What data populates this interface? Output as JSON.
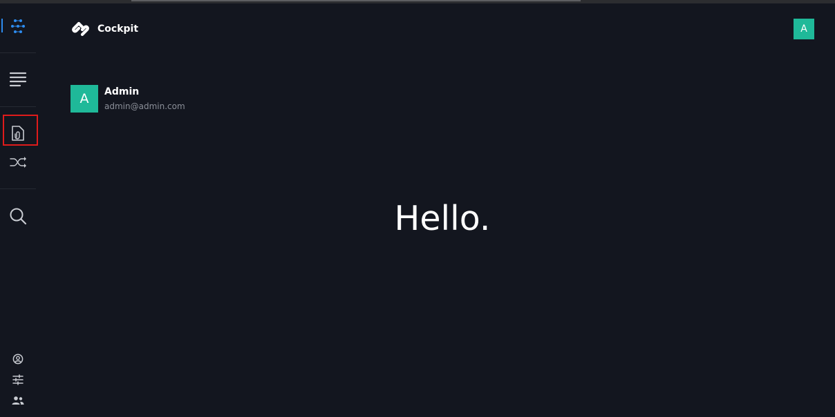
{
  "app": {
    "brand_name": "Cockpit"
  },
  "header": {
    "avatar_initial": "A"
  },
  "user": {
    "avatar_initial": "A",
    "name": "Admin",
    "email": "admin@admin.com"
  },
  "main": {
    "greeting": "Hello."
  },
  "sidebar": {
    "items": [
      {
        "icon": "dashboard-dots-icon",
        "active": true
      },
      {
        "icon": "content-list-icon"
      },
      {
        "icon": "assets-file-icon",
        "highlighted": true
      },
      {
        "icon": "shuffle-icon"
      },
      {
        "icon": "search-icon"
      },
      {
        "icon": "user-profile-icon"
      },
      {
        "icon": "settings-sliders-icon"
      },
      {
        "icon": "users-group-icon"
      }
    ]
  },
  "colors": {
    "background": "#13161f",
    "accent_blue": "#2d8cf0",
    "avatar_green": "#1fb999",
    "highlight_red": "#e01b1b"
  }
}
